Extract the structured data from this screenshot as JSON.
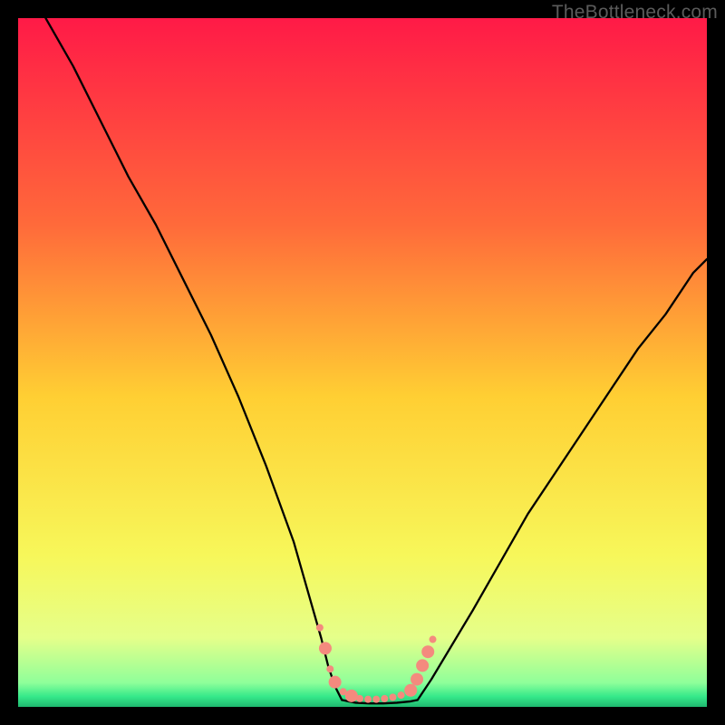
{
  "watermark": "TheBottleneck.com",
  "chart_data": {
    "type": "line",
    "title": "",
    "xlabel": "",
    "ylabel": "",
    "xlim": [
      0,
      100
    ],
    "ylim": [
      0,
      100
    ],
    "grid": false,
    "legend": false,
    "background_gradient": {
      "stops": [
        {
          "offset": 0.0,
          "color": "#ff1a47"
        },
        {
          "offset": 0.3,
          "color": "#ff6a3a"
        },
        {
          "offset": 0.55,
          "color": "#ffcf33"
        },
        {
          "offset": 0.78,
          "color": "#f7f75a"
        },
        {
          "offset": 0.9,
          "color": "#e5ff8a"
        },
        {
          "offset": 0.965,
          "color": "#8fff9a"
        },
        {
          "offset": 0.985,
          "color": "#35e98a"
        },
        {
          "offset": 1.0,
          "color": "#1fb86f"
        }
      ]
    },
    "series": [
      {
        "name": "left-curve",
        "x": [
          4,
          8,
          12,
          16,
          20,
          24,
          28,
          32,
          36,
          40,
          42,
          44,
          45,
          46,
          47
        ],
        "y": [
          100,
          93,
          85,
          77,
          70,
          62,
          54,
          45,
          35,
          24,
          17,
          10,
          6,
          3,
          1
        ]
      },
      {
        "name": "valley-floor",
        "x": [
          47,
          49,
          51,
          53,
          55,
          57,
          58
        ],
        "y": [
          1,
          0.6,
          0.5,
          0.5,
          0.6,
          0.8,
          1
        ]
      },
      {
        "name": "right-curve",
        "x": [
          58,
          60,
          63,
          66,
          70,
          74,
          78,
          82,
          86,
          90,
          94,
          98,
          100
        ],
        "y": [
          1,
          4,
          9,
          14,
          21,
          28,
          34,
          40,
          46,
          52,
          57,
          63,
          65
        ]
      }
    ],
    "markers": {
      "name": "valley-markers",
      "color": "#f48a7e",
      "radius_small": 4,
      "radius_large": 7,
      "points": [
        {
          "x": 43.8,
          "y": 11.5,
          "r": "small"
        },
        {
          "x": 44.6,
          "y": 8.5,
          "r": "large"
        },
        {
          "x": 45.3,
          "y": 5.5,
          "r": "small"
        },
        {
          "x": 46.0,
          "y": 3.6,
          "r": "large"
        },
        {
          "x": 47.2,
          "y": 2.2,
          "r": "small"
        },
        {
          "x": 48.4,
          "y": 1.6,
          "r": "large"
        },
        {
          "x": 49.6,
          "y": 1.2,
          "r": "small"
        },
        {
          "x": 50.8,
          "y": 1.1,
          "r": "small"
        },
        {
          "x": 52.0,
          "y": 1.1,
          "r": "small"
        },
        {
          "x": 53.2,
          "y": 1.2,
          "r": "small"
        },
        {
          "x": 54.4,
          "y": 1.4,
          "r": "small"
        },
        {
          "x": 55.6,
          "y": 1.7,
          "r": "small"
        },
        {
          "x": 57.0,
          "y": 2.4,
          "r": "large"
        },
        {
          "x": 57.9,
          "y": 4.0,
          "r": "large"
        },
        {
          "x": 58.7,
          "y": 6.0,
          "r": "large"
        },
        {
          "x": 59.5,
          "y": 8.0,
          "r": "large"
        },
        {
          "x": 60.2,
          "y": 9.8,
          "r": "small"
        }
      ]
    }
  }
}
